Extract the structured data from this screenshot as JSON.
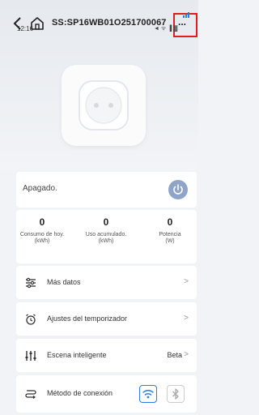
{
  "header": {
    "device_title": "SS:SP16WB01O251700067",
    "more_label": "..."
  },
  "status_bar": {
    "time": "12:16",
    "status_icons_text": "◄ ᯤ ▐ ▓"
  },
  "power": {
    "state_label": "Apagado."
  },
  "stats": [
    {
      "value": "0",
      "label": "Consumo de hoy.",
      "unit": "(kWh)"
    },
    {
      "value": "0",
      "label": "Uso acumulado.",
      "unit": "(kWh)"
    },
    {
      "value": "0",
      "label": "Potencia",
      "unit": "(W)"
    }
  ],
  "menu": {
    "more_data": "Más datos",
    "timer_settings": "Ajustes del temporizador",
    "smart_scene": "Escena inteligente",
    "smart_scene_badge": "Beta",
    "connection_method": "Método de conexión"
  },
  "colors": {
    "accent": "#2a7de0",
    "power_button": "#8fa4c9",
    "highlight": "#e01e1e"
  }
}
